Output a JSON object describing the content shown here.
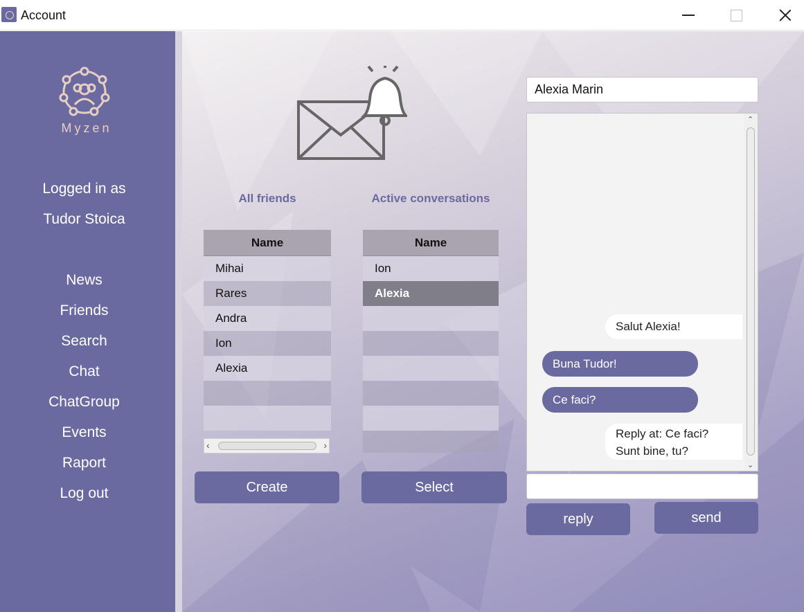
{
  "window": {
    "title": "Account"
  },
  "sidebar": {
    "logo_text": "Myzen",
    "login_label": "Logged in as",
    "user_name": "Tudor Stoica",
    "nav": [
      "News",
      "Friends",
      "Search",
      "Chat",
      "ChatGroup",
      "Events",
      "Raport",
      "Log out"
    ]
  },
  "friends": {
    "title": "All friends",
    "header": "Name",
    "rows": [
      "Mihai",
      "Rares",
      "Andra",
      "Ion",
      "Alexia"
    ],
    "button": "Create"
  },
  "conversations": {
    "title": "Active conversations",
    "header": "Name",
    "rows": [
      "Ion",
      "Alexia"
    ],
    "selected": "Alexia",
    "button": "Select"
  },
  "chat": {
    "contact": "Alexia Marin",
    "messages": [
      {
        "direction": "in",
        "text": "Salut Alexia!"
      },
      {
        "direction": "out",
        "text": "Buna Tudor!"
      },
      {
        "direction": "out",
        "text": "Ce faci?"
      },
      {
        "direction": "in",
        "text": "Reply at: Ce faci?\nSunt bine, tu?"
      }
    ],
    "input_value": "",
    "reply_label": "reply",
    "send_label": "send"
  },
  "colors": {
    "accent": "#6b6aa0",
    "selected_row": "#807e88"
  }
}
